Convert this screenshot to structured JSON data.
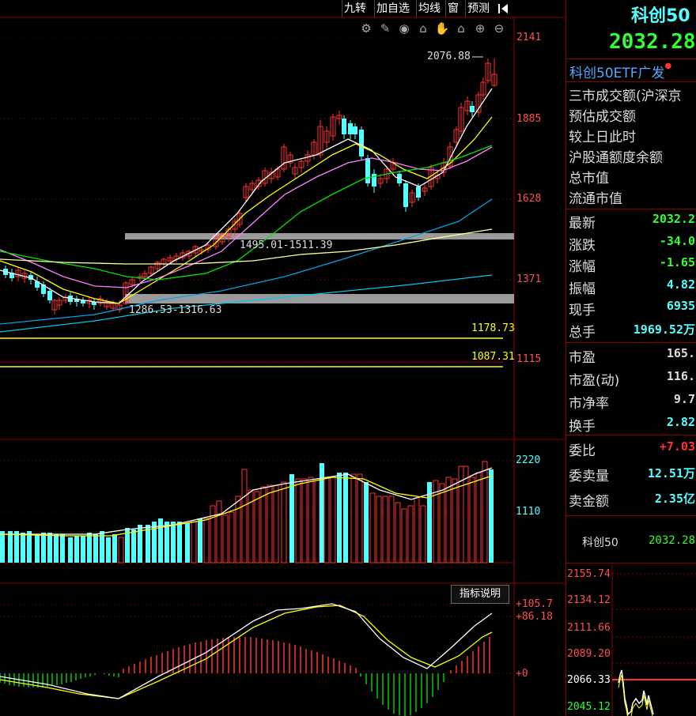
{
  "toolbar": {
    "items": [
      "九转",
      "加自选",
      "均线",
      "窗",
      "预测"
    ],
    "tool_icons": [
      "settings-icon",
      "draw-icon",
      "eye-icon",
      "lock-icon",
      "hand-icon",
      "home-icon",
      "zoom-in-icon",
      "zoom-out-icon"
    ]
  },
  "price_axis": [
    "2141",
    "1885",
    "1628",
    "1371",
    "1115"
  ],
  "volume_axis": [
    "2220",
    "1110"
  ],
  "macd_axis": [
    "+105.7",
    "+86.18",
    "+0"
  ],
  "annotations": {
    "high": "2076.88",
    "range1": "1495.01-1511.39",
    "range2": "1286.53-1316.63",
    "level1": "1178.73",
    "level2": "1087.31"
  },
  "indicator_button": "指标说明",
  "sidebar": {
    "title": "科创50",
    "price": "2032.28",
    "etf_link": "科创50ETF广发",
    "info_rows": [
      "三市成交额(沪深京",
      "预估成交额",
      "较上日此时",
      "沪股通额度余额",
      "总市值",
      "流通市值"
    ],
    "stats": [
      {
        "label": "最新",
        "value": "2032.2"
      },
      {
        "label": "涨跌",
        "value": "-34.0"
      },
      {
        "label": "涨幅",
        "value": "-1.65"
      },
      {
        "label": "振幅",
        "value": "4.82"
      },
      {
        "label": "现手",
        "value": "6935"
      },
      {
        "label": "总手",
        "value": "1969.52万"
      }
    ],
    "valuation": [
      {
        "label": "市盈",
        "value": "165."
      },
      {
        "label": "市盈(动)",
        "value": "116."
      },
      {
        "label": "市净率",
        "value": "9.7"
      },
      {
        "label": "换手",
        "value": "2.82"
      }
    ],
    "order": [
      {
        "label": "委比",
        "value": "+7.03"
      },
      {
        "label": "委卖量",
        "value": "12.51万"
      },
      {
        "label": "卖金额",
        "value": "2.35亿"
      }
    ],
    "mini_name": "科创50",
    "mini_price": "2032.28",
    "mini_axis": [
      "2155.74",
      "2134.12",
      "2111.66",
      "2089.20",
      "2066.33",
      "2045.12"
    ]
  },
  "colors": {
    "up": "#ff3232",
    "down": "#54ffff",
    "ma5": "#ffffff",
    "ma10": "#ffff00",
    "ma20": "#ff80ff",
    "ma30": "#00e600",
    "ma60": "#00a2e8",
    "ma120": "#ffffa0"
  }
}
